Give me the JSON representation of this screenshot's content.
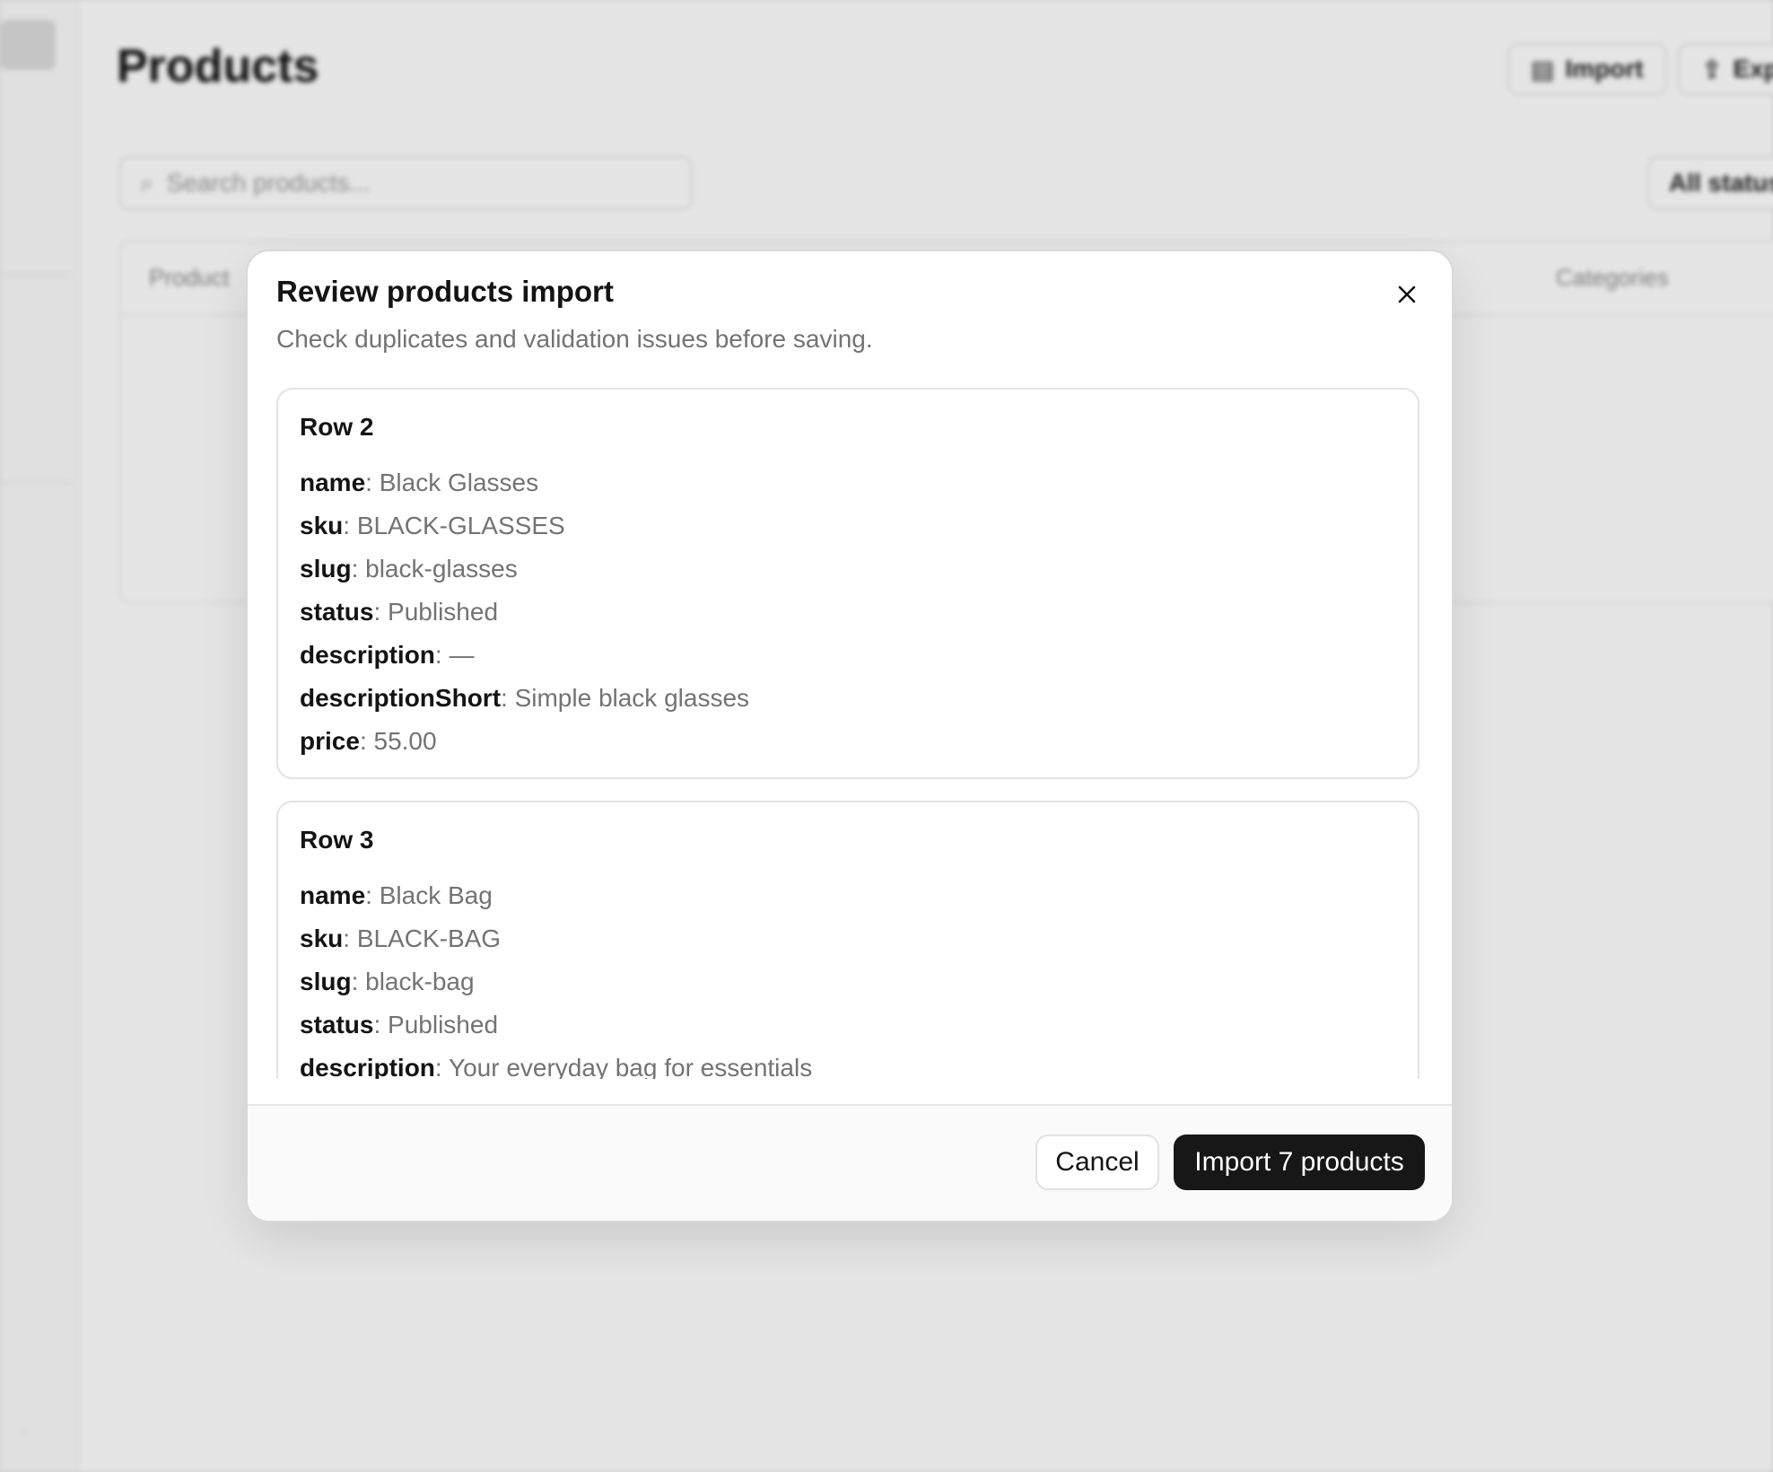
{
  "background": {
    "page_title": "Products",
    "import_label": "Import",
    "export_label": "Export",
    "search_placeholder": "Search products...",
    "filter_label": "All statuses",
    "table_headers": [
      "Product",
      "Categories"
    ]
  },
  "modal": {
    "title": "Review products import",
    "subtitle": "Check duplicates and validation issues before saving.",
    "rows": [
      {
        "title": "Row 2",
        "fields": [
          {
            "key": "name",
            "value": "Black Glasses"
          },
          {
            "key": "sku",
            "value": "BLACK-GLASSES"
          },
          {
            "key": "slug",
            "value": "black-glasses"
          },
          {
            "key": "status",
            "value": "Published"
          },
          {
            "key": "description",
            "value": "—"
          },
          {
            "key": "descriptionShort",
            "value": "Simple black glasses"
          },
          {
            "key": "price",
            "value": "55.00"
          }
        ]
      },
      {
        "title": "Row 3",
        "fields": [
          {
            "key": "name",
            "value": "Black Bag"
          },
          {
            "key": "sku",
            "value": "BLACK-BAG"
          },
          {
            "key": "slug",
            "value": "black-bag"
          },
          {
            "key": "status",
            "value": "Published"
          },
          {
            "key": "description",
            "value": "Your everyday bag for essentials"
          }
        ]
      }
    ],
    "cancel_label": "Cancel",
    "import_label": "Import 7 products",
    "close_icon": "close-icon"
  },
  "colors": {
    "primary_button": "#171717",
    "muted_text": "#737373",
    "text": "#141414"
  }
}
